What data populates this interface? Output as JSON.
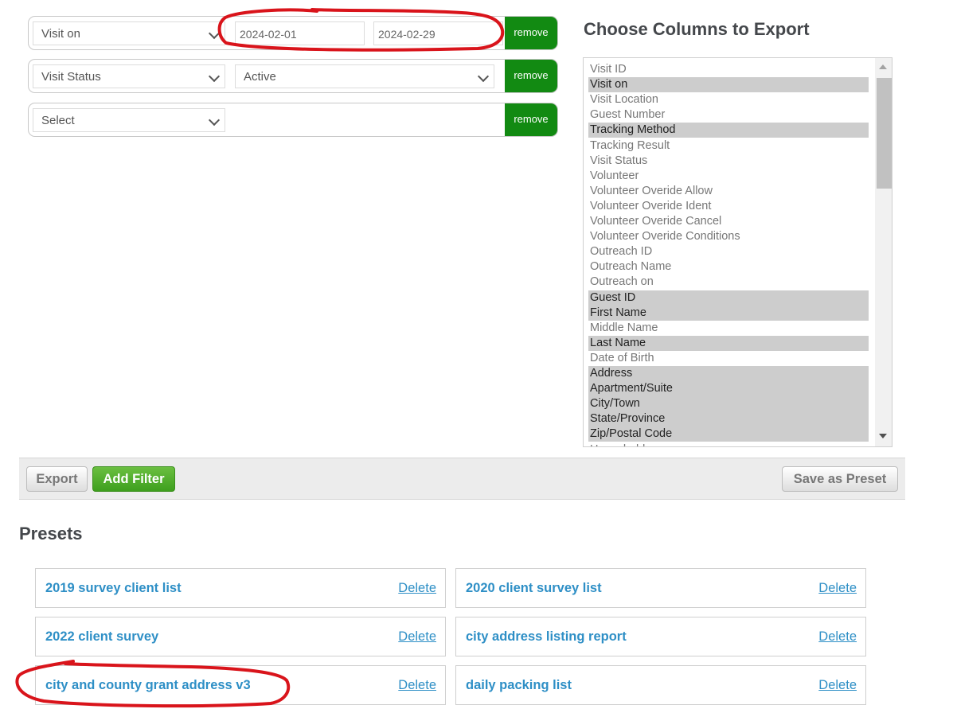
{
  "filters": [
    {
      "field": "Visit on",
      "from": "2024-02-01",
      "to": "2024-02-29",
      "remove": "remove"
    },
    {
      "field": "Visit Status",
      "value": "Active",
      "remove": "remove"
    },
    {
      "field": "Select",
      "remove": "remove"
    }
  ],
  "columns": {
    "title": "Choose Columns to Export",
    "options": [
      {
        "label": "Visit ID",
        "selected": false
      },
      {
        "label": "Visit on",
        "selected": true
      },
      {
        "label": "Visit Location",
        "selected": false
      },
      {
        "label": "Guest Number",
        "selected": false
      },
      {
        "label": "Tracking Method",
        "selected": true
      },
      {
        "label": "Tracking Result",
        "selected": false
      },
      {
        "label": "Visit Status",
        "selected": false
      },
      {
        "label": "Volunteer",
        "selected": false
      },
      {
        "label": "Volunteer Overide Allow",
        "selected": false
      },
      {
        "label": "Volunteer Overide Ident",
        "selected": false
      },
      {
        "label": "Volunteer Overide Cancel",
        "selected": false
      },
      {
        "label": "Volunteer Overide Conditions",
        "selected": false
      },
      {
        "label": "Outreach ID",
        "selected": false
      },
      {
        "label": "Outreach Name",
        "selected": false
      },
      {
        "label": "Outreach on",
        "selected": false
      },
      {
        "label": "Guest ID",
        "selected": true
      },
      {
        "label": "First Name",
        "selected": true
      },
      {
        "label": "Middle Name",
        "selected": false
      },
      {
        "label": "Last Name",
        "selected": true
      },
      {
        "label": "Date of Birth",
        "selected": false
      },
      {
        "label": "Address",
        "selected": true
      },
      {
        "label": "Apartment/Suite",
        "selected": true
      },
      {
        "label": "City/Town",
        "selected": true
      },
      {
        "label": "State/Province",
        "selected": true
      },
      {
        "label": "Zip/Postal Code",
        "selected": true
      },
      {
        "label": "Household",
        "selected": false
      }
    ]
  },
  "actions": {
    "export": "Export",
    "add_filter": "Add Filter",
    "save_preset": "Save as Preset"
  },
  "presets": {
    "title": "Presets",
    "items": [
      {
        "name": "2019 survey client list",
        "delete": "Delete"
      },
      {
        "name": "2020 client survey list",
        "delete": "Delete"
      },
      {
        "name": "2022 client survey",
        "delete": "Delete"
      },
      {
        "name": "city address listing report",
        "delete": "Delete"
      },
      {
        "name": "city and county grant address v3",
        "delete": "Delete"
      },
      {
        "name": "daily packing list",
        "delete": "Delete"
      }
    ]
  },
  "colors": {
    "remove_green": "#128a12",
    "add_filter_green": "#4ea82a",
    "link_blue": "#2e8fc6",
    "annotation_red": "#d9141b",
    "selected_option": "#cdcdcd"
  }
}
